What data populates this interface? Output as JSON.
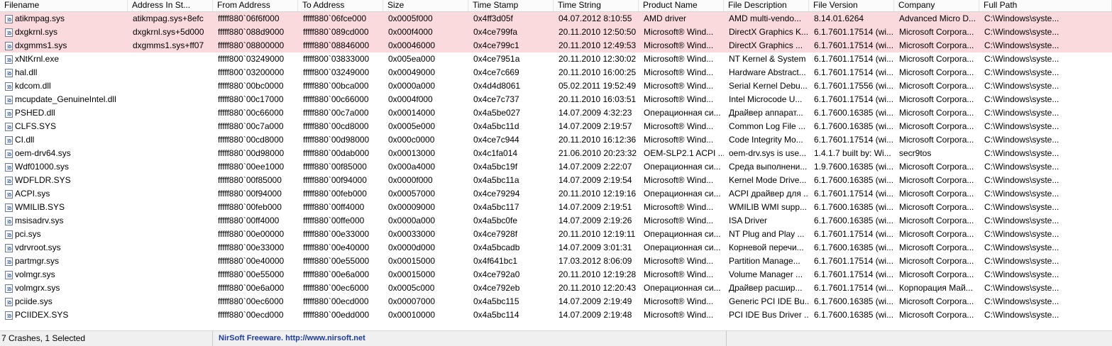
{
  "columns": [
    "Filename",
    "Address In St...",
    "From Address",
    "To Address",
    "Size",
    "Time Stamp",
    "Time String",
    "Product Name",
    "File Description",
    "File Version",
    "Company",
    "Full Path"
  ],
  "rows": [
    {
      "h": true,
      "c": [
        "atikmpag.sys",
        "atikmpag.sys+8efc",
        "fffff880`06f6f000",
        "fffff880`06fce000",
        "0x0005f000",
        "0x4ff3d05f",
        "04.07.2012 8:10:55",
        "AMD driver",
        "AMD multi-vendo...",
        "8.14.01.6264",
        "Advanced Micro D...",
        "C:\\Windows\\syste..."
      ]
    },
    {
      "h": true,
      "c": [
        "dxgkrnl.sys",
        "dxgkrnl.sys+5d000",
        "fffff880`088d9000",
        "fffff880`089cd000",
        "0x000f4000",
        "0x4ce799fa",
        "20.11.2010 12:50:50",
        "Microsoft® Wind...",
        "DirectX Graphics K...",
        "6.1.7601.17514 (wi...",
        "Microsoft Corpora...",
        "C:\\Windows\\syste..."
      ]
    },
    {
      "h": true,
      "c": [
        "dxgmms1.sys",
        "dxgmms1.sys+ff07",
        "fffff880`08800000",
        "fffff880`08846000",
        "0x00046000",
        "0x4ce799c1",
        "20.11.2010 12:49:53",
        "Microsoft® Wind...",
        "DirectX Graphics ...",
        "6.1.7601.17514 (wi...",
        "Microsoft Corpora...",
        "C:\\Windows\\syste..."
      ]
    },
    {
      "h": false,
      "c": [
        "xNtKrnl.exe",
        "",
        "fffff800`03249000",
        "fffff800`03833000",
        "0x005ea000",
        "0x4ce7951a",
        "20.11.2010 12:30:02",
        "Microsoft® Wind...",
        "NT Kernel & System",
        "6.1.7601.17514 (wi...",
        "Microsoft Corpora...",
        "C:\\Windows\\syste..."
      ]
    },
    {
      "h": false,
      "c": [
        "hal.dll",
        "",
        "fffff800`03200000",
        "fffff800`03249000",
        "0x00049000",
        "0x4ce7c669",
        "20.11.2010 16:00:25",
        "Microsoft® Wind...",
        "Hardware Abstract...",
        "6.1.7601.17514 (wi...",
        "Microsoft Corpora...",
        "C:\\Windows\\syste..."
      ]
    },
    {
      "h": false,
      "c": [
        "kdcom.dll",
        "",
        "fffff880`00bc0000",
        "fffff880`00bca000",
        "0x0000a000",
        "0x4d4d8061",
        "05.02.2011 19:52:49",
        "Microsoft® Wind...",
        "Serial Kernel Debu...",
        "6.1.7601.17556 (wi...",
        "Microsoft Corpora...",
        "C:\\Windows\\syste..."
      ]
    },
    {
      "h": false,
      "c": [
        "mcupdate_GenuineIntel.dll",
        "",
        "fffff880`00c17000",
        "fffff880`00c66000",
        "0x0004f000",
        "0x4ce7c737",
        "20.11.2010 16:03:51",
        "Microsoft® Wind...",
        "Intel Microcode U...",
        "6.1.7601.17514 (wi...",
        "Microsoft Corpora...",
        "C:\\Windows\\syste..."
      ]
    },
    {
      "h": false,
      "c": [
        "PSHED.dll",
        "",
        "fffff880`00c66000",
        "fffff880`00c7a000",
        "0x00014000",
        "0x4a5be027",
        "14.07.2009 4:32:23",
        "Операционная си...",
        "Драйвер аппарат...",
        "6.1.7600.16385 (wi...",
        "Microsoft Corpora...",
        "C:\\Windows\\syste..."
      ]
    },
    {
      "h": false,
      "c": [
        "CLFS.SYS",
        "",
        "fffff880`00c7a000",
        "fffff880`00cd8000",
        "0x0005e000",
        "0x4a5bc11d",
        "14.07.2009 2:19:57",
        "Microsoft® Wind...",
        "Common Log File ...",
        "6.1.7600.16385 (wi...",
        "Microsoft Corpora...",
        "C:\\Windows\\syste..."
      ]
    },
    {
      "h": false,
      "c": [
        "CI.dll",
        "",
        "fffff880`00cd8000",
        "fffff880`00d98000",
        "0x000c0000",
        "0x4ce7c944",
        "20.11.2010 16:12:36",
        "Microsoft® Wind...",
        "Code Integrity Mo...",
        "6.1.7601.17514 (wi...",
        "Microsoft Corpora...",
        "C:\\Windows\\syste..."
      ]
    },
    {
      "h": false,
      "c": [
        "oem-drv64.sys",
        "",
        "fffff880`00d98000",
        "fffff880`00dab000",
        "0x00013000",
        "0x4c1fa014",
        "21.06.2010 20:23:32",
        "OEM-SLP2.1 ACPI ...",
        "oem-drv.sys is use...",
        "1.4.1.7 built by: Wi...",
        "secr9tos",
        "C:\\Windows\\syste..."
      ]
    },
    {
      "h": false,
      "c": [
        "Wdf01000.sys",
        "",
        "fffff880`00ee1000",
        "fffff880`00f85000",
        "0x000a4000",
        "0x4a5bc19f",
        "14.07.2009 2:22:07",
        "Операционная си...",
        "Среда выполнени...",
        "1.9.7600.16385 (wi...",
        "Microsoft Corpora...",
        "C:\\Windows\\syste..."
      ]
    },
    {
      "h": false,
      "c": [
        "WDFLDR.SYS",
        "",
        "fffff880`00f85000",
        "fffff880`00f94000",
        "0x0000f000",
        "0x4a5bc11a",
        "14.07.2009 2:19:54",
        "Microsoft® Wind...",
        "Kernel Mode Drive...",
        "6.1.7600.16385 (wi...",
        "Microsoft Corpora...",
        "C:\\Windows\\syste..."
      ]
    },
    {
      "h": false,
      "c": [
        "ACPI.sys",
        "",
        "fffff880`00f94000",
        "fffff880`00feb000",
        "0x00057000",
        "0x4ce79294",
        "20.11.2010 12:19:16",
        "Операционная си...",
        "ACPI драйвер для ...",
        "6.1.7601.17514 (wi...",
        "Microsoft Corpora...",
        "C:\\Windows\\syste..."
      ]
    },
    {
      "h": false,
      "c": [
        "WMILIB.SYS",
        "",
        "fffff880`00feb000",
        "fffff880`00ff4000",
        "0x00009000",
        "0x4a5bc117",
        "14.07.2009 2:19:51",
        "Microsoft® Wind...",
        "WMILIB WMI supp...",
        "6.1.7600.16385 (wi...",
        "Microsoft Corpora...",
        "C:\\Windows\\syste..."
      ]
    },
    {
      "h": false,
      "c": [
        "msisadrv.sys",
        "",
        "fffff880`00ff4000",
        "fffff880`00ffe000",
        "0x0000a000",
        "0x4a5bc0fe",
        "14.07.2009 2:19:26",
        "Microsoft® Wind...",
        "ISA Driver",
        "6.1.7600.16385 (wi...",
        "Microsoft Corpora...",
        "C:\\Windows\\syste..."
      ]
    },
    {
      "h": false,
      "c": [
        "pci.sys",
        "",
        "fffff880`00e00000",
        "fffff880`00e33000",
        "0x00033000",
        "0x4ce7928f",
        "20.11.2010 12:19:11",
        "Операционная си...",
        "NT Plug and Play ...",
        "6.1.7601.17514 (wi...",
        "Microsoft Corpora...",
        "C:\\Windows\\syste..."
      ]
    },
    {
      "h": false,
      "c": [
        "vdrvroot.sys",
        "",
        "fffff880`00e33000",
        "fffff880`00e40000",
        "0x0000d000",
        "0x4a5bcadb",
        "14.07.2009 3:01:31",
        "Операционная си...",
        "Корневой перечи...",
        "6.1.7600.16385 (wi...",
        "Microsoft Corpora...",
        "C:\\Windows\\syste..."
      ]
    },
    {
      "h": false,
      "c": [
        "partmgr.sys",
        "",
        "fffff880`00e40000",
        "fffff880`00e55000",
        "0x00015000",
        "0x4f641bc1",
        "17.03.2012 8:06:09",
        "Microsoft® Wind...",
        "Partition Manage...",
        "6.1.7601.17514 (wi...",
        "Microsoft Corpora...",
        "C:\\Windows\\syste..."
      ]
    },
    {
      "h": false,
      "c": [
        "volmgr.sys",
        "",
        "fffff880`00e55000",
        "fffff880`00e6a000",
        "0x00015000",
        "0x4ce792a0",
        "20.11.2010 12:19:28",
        "Microsoft® Wind...",
        "Volume Manager ...",
        "6.1.7601.17514 (wi...",
        "Microsoft Corpora...",
        "C:\\Windows\\syste..."
      ]
    },
    {
      "h": false,
      "c": [
        "volmgrx.sys",
        "",
        "fffff880`00e6a000",
        "fffff880`00ec6000",
        "0x0005c000",
        "0x4ce792eb",
        "20.11.2010 12:20:43",
        "Операционная си...",
        "Драйвер расшир...",
        "6.1.7601.17514 (wi...",
        "Корпорация Май...",
        "C:\\Windows\\syste..."
      ]
    },
    {
      "h": false,
      "c": [
        "pciide.sys",
        "",
        "fffff880`00ec6000",
        "fffff880`00ecd000",
        "0x00007000",
        "0x4a5bc115",
        "14.07.2009 2:19:49",
        "Microsoft® Wind...",
        "Generic PCI IDE Bu...",
        "6.1.7600.16385 (wi...",
        "Microsoft Corpora...",
        "C:\\Windows\\syste..."
      ]
    },
    {
      "h": false,
      "c": [
        "PCIIDEX.SYS",
        "",
        "fffff880`00ecd000",
        "fffff880`00edd000",
        "0x00010000",
        "0x4a5bc114",
        "14.07.2009 2:19:48",
        "Microsoft® Wind...",
        "PCI IDE Bus Driver ...",
        "6.1.7600.16385 (wi...",
        "Microsoft Corpora...",
        "C:\\Windows\\syste..."
      ]
    }
  ],
  "status": {
    "left": "7 Crashes, 1 Selected",
    "link": "NirSoft Freeware.  http://www.nirsoft.net"
  },
  "colors": {
    "highlight": "#fadadd",
    "link": "#1e3c9c"
  },
  "icons": {
    "file": "driver-file-icon"
  }
}
